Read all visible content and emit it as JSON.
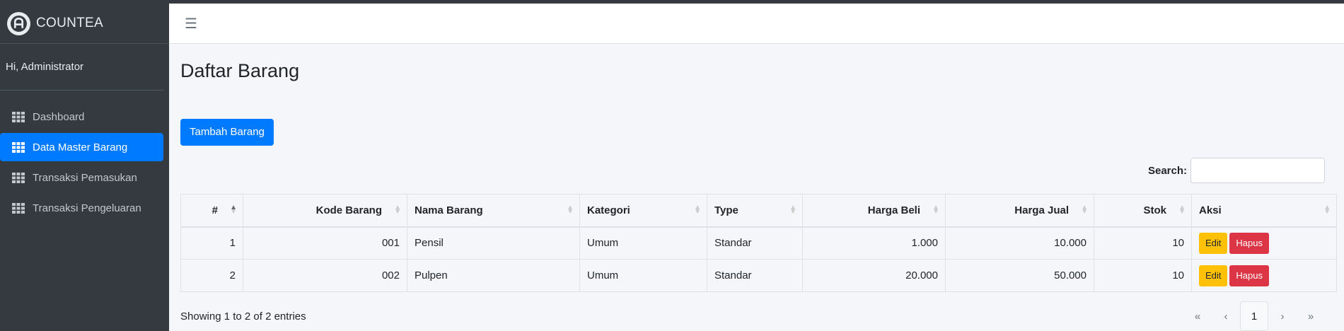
{
  "brand": {
    "name": "COUNTEA"
  },
  "user": {
    "greeting": "Hi, Administrator"
  },
  "sidebar": {
    "items": [
      {
        "label": "Dashboard",
        "icon": "grid-icon"
      },
      {
        "label": "Data Master Barang",
        "icon": "grid-icon",
        "active": true
      },
      {
        "label": "Transaksi Pemasukan",
        "icon": "grid-icon"
      },
      {
        "label": "Transaksi Pengeluaran",
        "icon": "grid-icon"
      }
    ]
  },
  "page": {
    "title": "Daftar Barang",
    "add_button": "Tambah Barang",
    "search_label": "Search:",
    "search_value": ""
  },
  "table": {
    "headers": [
      "#",
      "Kode Barang",
      "Nama Barang",
      "Kategori",
      "Type",
      "Harga Beli",
      "Harga Jual",
      "Stok",
      "Aksi"
    ],
    "rows": [
      {
        "no": "1",
        "kode": "001",
        "nama": "Pensil",
        "kategori": "Umum",
        "type": "Standar",
        "beli": "1.000",
        "jual": "10.000",
        "stok": "10"
      },
      {
        "no": "2",
        "kode": "002",
        "nama": "Pulpen",
        "kategori": "Umum",
        "type": "Standar",
        "beli": "20.000",
        "jual": "50.000",
        "stok": "10"
      }
    ],
    "edit_label": "Edit",
    "delete_label": "Hapus"
  },
  "footer": {
    "info": "Showing 1 to 2 of 2 entries",
    "pagination": {
      "first": "«",
      "prev": "‹",
      "current": "1",
      "next": "›",
      "last": "»"
    }
  },
  "colors": {
    "primary": "#007bff",
    "sidebar": "#343a40",
    "warning": "#ffc107",
    "danger": "#dc3545"
  }
}
